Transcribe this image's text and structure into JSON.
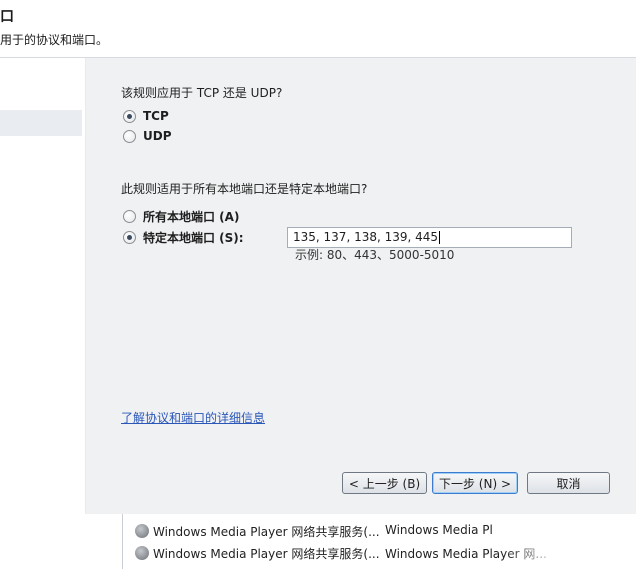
{
  "header": {
    "title": "口",
    "description": "用于的协议和端口。"
  },
  "protocol": {
    "question": "该规则应用于 TCP 还是 UDP?",
    "options": [
      {
        "label": "TCP",
        "checked": true
      },
      {
        "label": "UDP",
        "checked": false
      }
    ]
  },
  "ports": {
    "question": "此规则适用于所有本地端口还是特定本地端口?",
    "options": [
      {
        "label": "所有本地端口 (A)",
        "checked": false
      },
      {
        "label": "特定本地端口 (S):",
        "checked": true
      }
    ],
    "value": "135, 137, 138, 139, 445",
    "example": "示例: 80、443、5000-5010"
  },
  "link": {
    "label": "了解协议和端口的详细信息"
  },
  "buttons": {
    "back": "< 上一步 (B)",
    "next": "下一步 (N) >",
    "cancel": "取消"
  },
  "background_list": {
    "rows": [
      {
        "name": "Windows Media Player 网络共享服务(...",
        "group": "Windows Media Pl"
      },
      {
        "name": "Windows Media Player 网络共享服务(...",
        "group": "Windows Media Player 网..."
      }
    ]
  }
}
